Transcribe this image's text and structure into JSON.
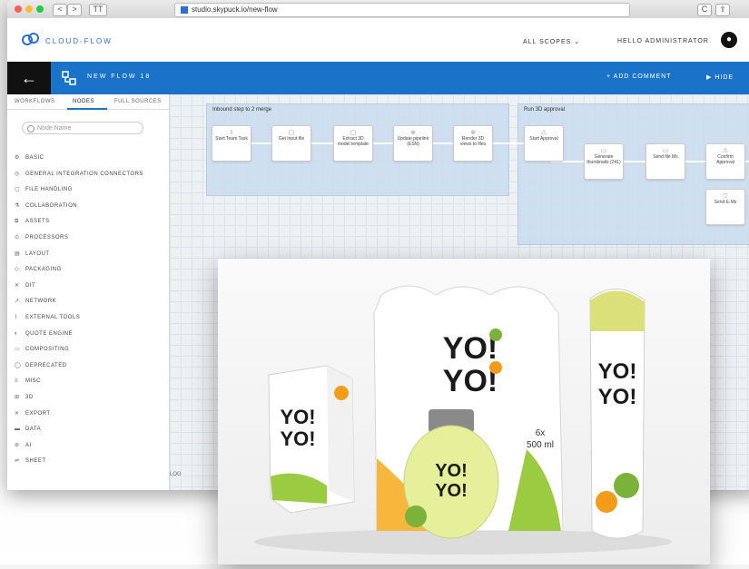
{
  "browser": {
    "url": "studio.skypuck.io/new-flow",
    "tab_label": "TT",
    "back_btn": "<",
    "forward_btn": ">",
    "reload_label": "C"
  },
  "app": {
    "brand": "CLOUD-FLOW",
    "scope_selector": "ALL SCOPES",
    "greeting": "HELLO ADMINISTRATOR"
  },
  "toolbar": {
    "back_icon": "←",
    "flow_title": "NEW FLOW 18",
    "add_comment": "+ ADD COMMENT",
    "hide_label": "▶ HIDE"
  },
  "sidebar": {
    "tabs": [
      "WORKFLOWS",
      "NODES",
      "FULL SOURCES"
    ],
    "search_placeholder": "Node Name",
    "categories": [
      {
        "icon": "⚙",
        "label": "BASIC"
      },
      {
        "icon": "◎",
        "label": "GENERAL INTEGRATION CONNECTORS"
      },
      {
        "icon": "▢",
        "label": "FILE HANDLING"
      },
      {
        "icon": "⚗",
        "label": "COLLABORATION"
      },
      {
        "icon": "⧉",
        "label": "ASSETS"
      },
      {
        "icon": "⊙",
        "label": "PROCESSORS"
      },
      {
        "icon": "▤",
        "label": "LAYOUT"
      },
      {
        "icon": "◇",
        "label": "PACKAGING"
      },
      {
        "icon": "✕",
        "label": "DIT"
      },
      {
        "icon": "↗",
        "label": "NETWORK"
      },
      {
        "icon": "⌇",
        "label": "EXTERNAL TOOLS"
      },
      {
        "icon": "◐",
        "label": "QUOTE ENGINE"
      },
      {
        "icon": "▭",
        "label": "COMPOSITING"
      },
      {
        "icon": "◯",
        "label": "DEPRECATED"
      },
      {
        "icon": "≡",
        "label": "MISC"
      },
      {
        "icon": "⊞",
        "label": "3D"
      },
      {
        "icon": "✕",
        "label": "EXPORT"
      },
      {
        "icon": "▬",
        "label": "DATA"
      },
      {
        "icon": "⊚",
        "label": "AI"
      },
      {
        "icon": "⇌",
        "label": "SHEET"
      }
    ]
  },
  "canvas": {
    "groups": [
      {
        "title": "Inbound step to 2 merge"
      },
      {
        "title": "Run 3D approval"
      }
    ],
    "nodes": [
      {
        "icon": "⇩",
        "label": "Start Team Task"
      },
      {
        "icon": "▢",
        "label": "Get Input file"
      },
      {
        "icon": "▢",
        "label": "Extract 3D model template"
      },
      {
        "icon": "⊗",
        "label": "Update pipeline (ESN)"
      },
      {
        "icon": "⊗",
        "label": "Render 3D views to files"
      },
      {
        "icon": "⚠",
        "label": "Start Approval"
      },
      {
        "icon": "▭",
        "label": "Generate thumbnails (241)"
      },
      {
        "icon": "▭",
        "label": "Send file Ms"
      },
      {
        "icon": "⚠",
        "label": "Confirm Approval"
      },
      {
        "icon": "▽",
        "label": "Send E-Ms"
      }
    ],
    "footer_label": "LOG"
  }
}
